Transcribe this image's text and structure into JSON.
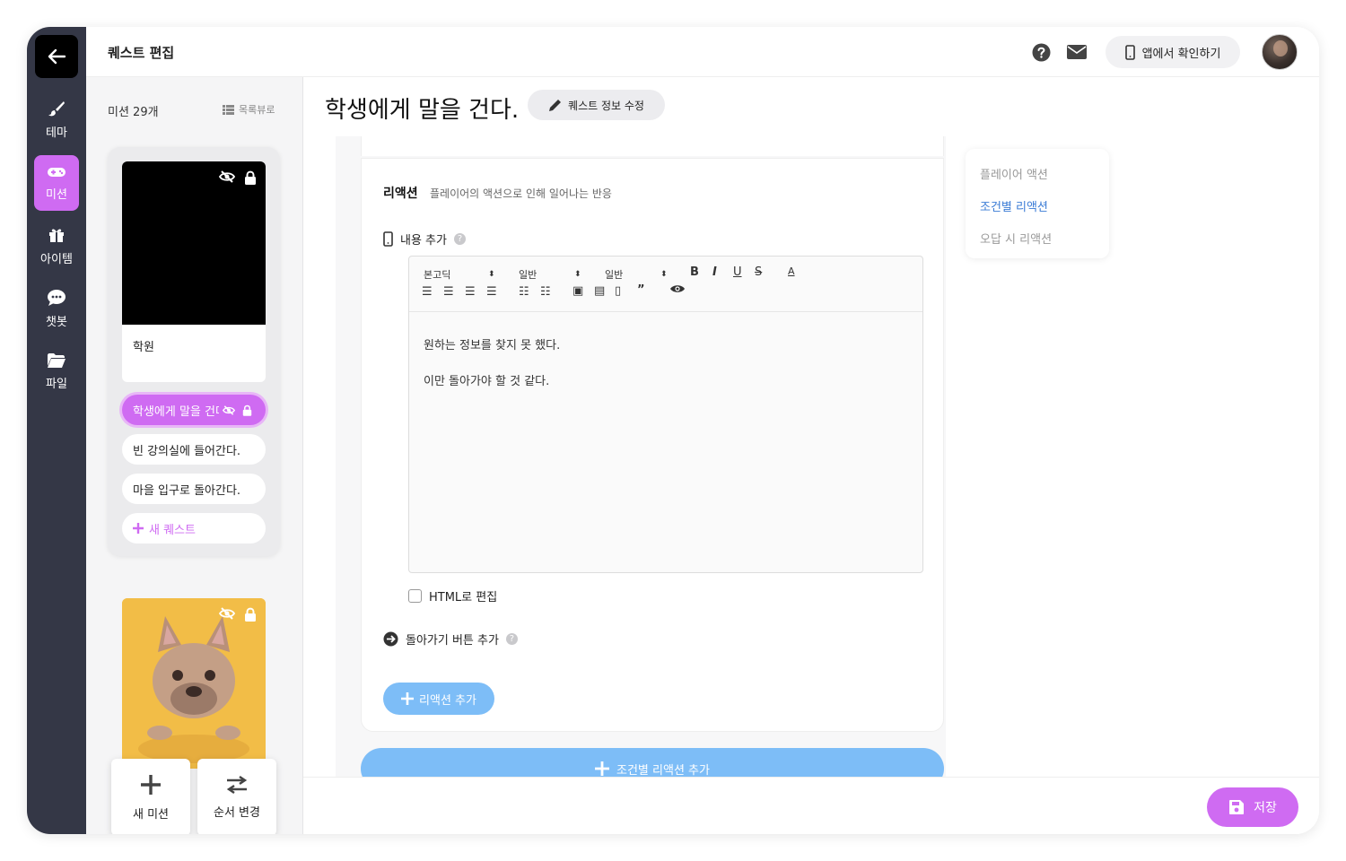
{
  "rail": {
    "items": [
      {
        "label": "테마",
        "icon": "brush-icon"
      },
      {
        "label": "미션",
        "icon": "gamepad-icon"
      },
      {
        "label": "아이템",
        "icon": "gift-icon"
      },
      {
        "label": "챗봇",
        "icon": "chat-icon"
      },
      {
        "label": "파일",
        "icon": "folder-icon"
      }
    ],
    "active_index": 1
  },
  "header": {
    "title": "퀘스트 편집",
    "app_check_label": "앱에서 확인하기"
  },
  "missions": {
    "count_label": "미션 29개",
    "list_view_label": "목록뷰로",
    "group": {
      "card_title": "학원",
      "quests": [
        {
          "label": "학생에게 말을 건다.",
          "active": true
        },
        {
          "label": "빈 강의실에 들어간다.",
          "active": false
        },
        {
          "label": "마을 입구로 돌아간다.",
          "active": false
        }
      ],
      "new_quest_label": "새 퀘스트"
    },
    "new_mission_label": "새 미션",
    "reorder_label": "순서 변경"
  },
  "main": {
    "quest_title": "학생에게 말을 건다.",
    "edit_info_label": "퀘스트 정보 수정",
    "reaction": {
      "title": "리액션",
      "description": "플레이어의 액션으로 인해 일어나는 반응",
      "add_content_label": "내용 추가",
      "help_glyph": "?",
      "editor": {
        "font_select": "본고딕",
        "size_select": "일반",
        "heading_select": "일반",
        "lines": [
          "원하는 정보를 찾지 못 했다.",
          "이만 돌아가야 할 것 같다."
        ]
      },
      "html_edit_label": "HTML로 편집",
      "html_edit_checked": false,
      "back_button_label": "돌아가기 버튼 추가",
      "add_reaction_label": "리액션 추가"
    },
    "add_conditional_label": "조건별 리액션 추가",
    "side_nav": [
      {
        "label": "플레이어 액션",
        "active": false
      },
      {
        "label": "조건별 리액션",
        "active": true
      },
      {
        "label": "오답 시 리액션",
        "active": false
      }
    ]
  },
  "footer": {
    "save_label": "저장"
  },
  "colors": {
    "accent": "#cf6bf2",
    "blue": "#7dbdf7",
    "rail": "#343746"
  }
}
